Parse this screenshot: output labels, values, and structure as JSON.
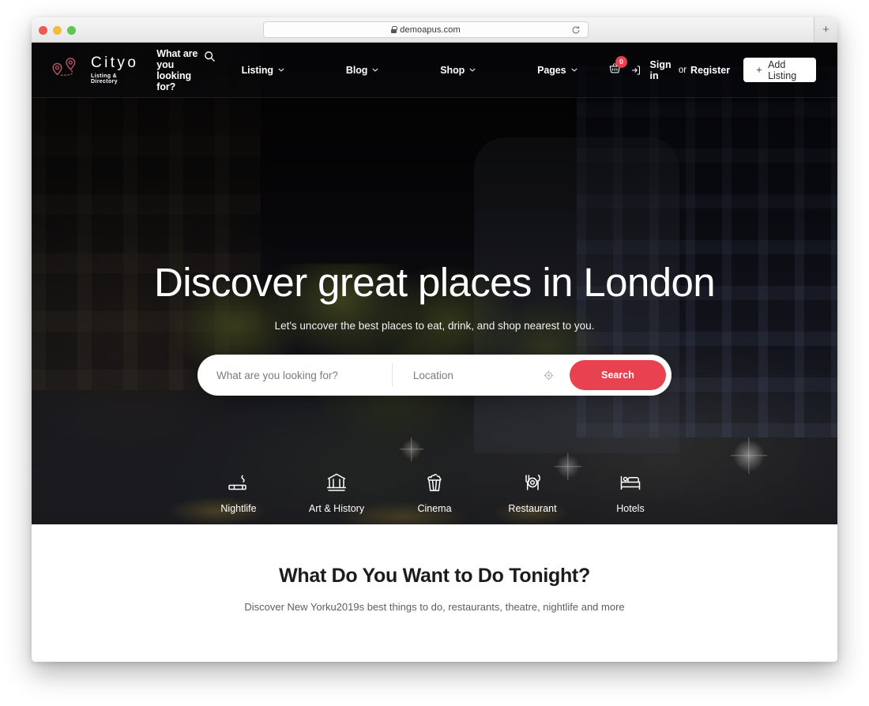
{
  "browser": {
    "url": "demoapus.com",
    "lock_icon": "lock-icon",
    "reload_icon": "reload-icon",
    "new_tab_label": "+",
    "traffic_lights": [
      "close",
      "minimize",
      "zoom"
    ]
  },
  "header": {
    "logo": {
      "name": "Cityo",
      "tagline": "Listing & Directory",
      "icon": "map-pin-route-icon"
    },
    "search_prompt": "What are you looking for?",
    "search_icon": "magnifier-icon",
    "nav": [
      {
        "label": "Listing",
        "icon": "chevron-down-icon"
      },
      {
        "label": "Blog",
        "icon": "chevron-down-icon"
      },
      {
        "label": "Shop",
        "icon": "chevron-down-icon"
      },
      {
        "label": "Pages",
        "icon": "chevron-down-icon"
      }
    ],
    "cart": {
      "icon": "shopping-basket-icon",
      "count": "0"
    },
    "login_icon": "sign-in-icon",
    "sign_in": "Sign in",
    "or": "or",
    "register": "Register",
    "add_listing": {
      "label": "Add Listing",
      "icon": "plus-icon"
    }
  },
  "hero": {
    "title": "Discover great places in London",
    "subtitle": "Let's uncover the best places to eat, drink, and shop nearest to you.",
    "search": {
      "keyword_placeholder": "What are you looking for?",
      "location_placeholder": "Location",
      "geo_icon": "crosshair-target-icon",
      "button_label": "Search"
    },
    "categories": [
      {
        "label": "Nightlife",
        "icon": "cigarette-icon"
      },
      {
        "label": "Art & History",
        "icon": "museum-icon"
      },
      {
        "label": "Cinema",
        "icon": "popcorn-icon"
      },
      {
        "label": "Restaurant",
        "icon": "cutlery-plate-icon"
      },
      {
        "label": "Hotels",
        "icon": "bed-icon"
      }
    ]
  },
  "tonight": {
    "title": "What Do You Want to Do Tonight?",
    "subtitle": "Discover New Yorku2019s best things to do, restaurants, theatre, nightlife and more"
  },
  "colors": {
    "accent_red": "#e8414f",
    "header_text": "#ffffff",
    "hero_bg_dark": "#0b0b0d",
    "section_bg": "#ffffff",
    "body_text": "#5e5e5e"
  }
}
